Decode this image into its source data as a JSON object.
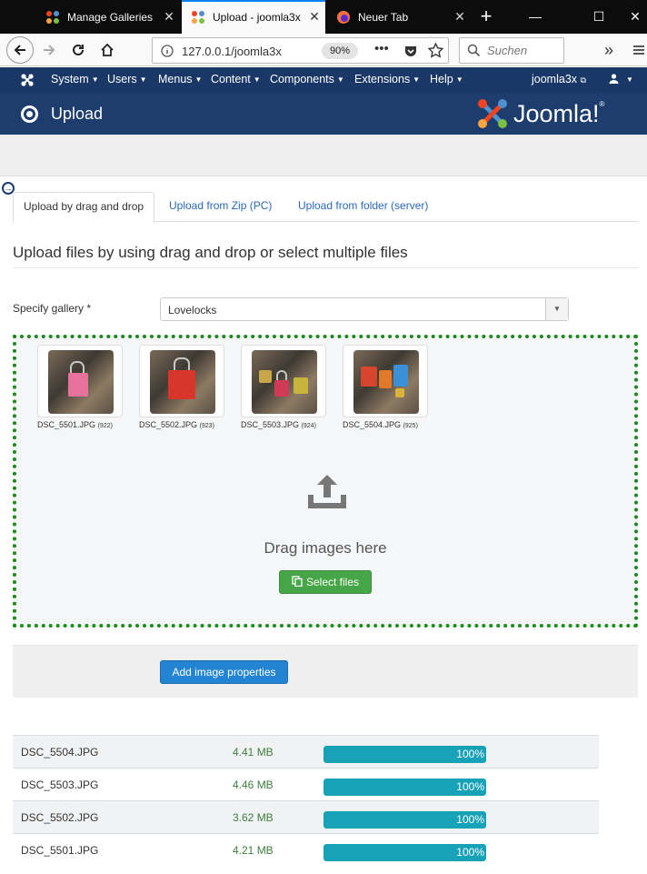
{
  "browser": {
    "tabs": [
      {
        "title": "Manage Galleries",
        "active": false
      },
      {
        "title": "Upload - joomla3x",
        "active": true
      },
      {
        "title": "Neuer Tab",
        "active": false
      }
    ],
    "url": "127.0.0.1/joomla3x",
    "zoom": "90%",
    "search_placeholder": "Suchen"
  },
  "admin_menu": {
    "items": [
      "System",
      "Users",
      "Menus",
      "Content",
      "Components",
      "Extensions",
      "Help"
    ],
    "site_name": "joomla3x"
  },
  "header": {
    "title": "Upload",
    "logo": "Joomla!"
  },
  "tabs": [
    {
      "label": "Upload by drag and drop",
      "active": true
    },
    {
      "label": "Upload from Zip (PC)",
      "active": false
    },
    {
      "label": "Upload from folder (server)",
      "active": false
    }
  ],
  "section_title": "Upload files by using drag and drop or select multiple files",
  "gallery": {
    "label": "Specify gallery *",
    "value": "Lovelocks"
  },
  "dropzone": {
    "thumbnails": [
      {
        "name": "DSC_5501.JPG",
        "id": "(922)"
      },
      {
        "name": "DSC_5502.JPG",
        "id": "(923)"
      },
      {
        "name": "DSC_5503.JPG",
        "id": "(924)"
      },
      {
        "name": "DSC_5504.JPG",
        "id": "(925)"
      }
    ],
    "drag_text": "Drag images here",
    "select_button": "Select files"
  },
  "add_properties_button": "Add image properties",
  "uploads": [
    {
      "file": "DSC_5504.JPG",
      "size": "4.41 MB",
      "progress": 100,
      "progress_label": "100%"
    },
    {
      "file": "DSC_5503.JPG",
      "size": "4.46 MB",
      "progress": 100,
      "progress_label": "100%"
    },
    {
      "file": "DSC_5502.JPG",
      "size": "3.62 MB",
      "progress": 100,
      "progress_label": "100%"
    },
    {
      "file": "DSC_5501.JPG",
      "size": "4.21 MB",
      "progress": 100,
      "progress_label": "100%"
    }
  ],
  "colors": {
    "menu_bar": "#1a3867",
    "header": "#1c3d6e",
    "select_button": "#46a546",
    "primary_button": "#2384d3",
    "progress": "#17a2b8",
    "dropzone_border": "#1a8a1a"
  }
}
